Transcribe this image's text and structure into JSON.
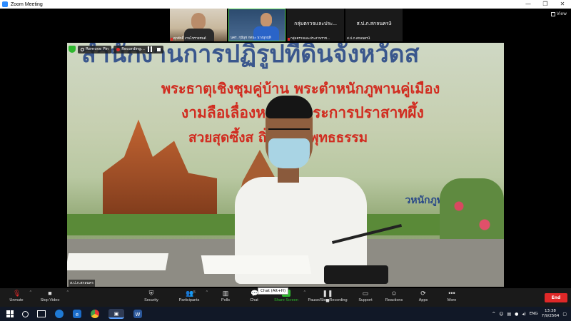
{
  "window": {
    "title": "Zoom Meeting",
    "controls": [
      "—",
      "❐",
      "✕"
    ]
  },
  "thumbnails": [
    {
      "label": "ศุภศักดิ์ งานไขรายชนด์",
      "muted": true
    },
    {
      "label": "นคร. กุนีนุช กตนะ นางนุกฤทิ",
      "muted": false
    },
    {
      "name": "กลุ่มตรวจและประ...",
      "label": "กลุ่มตรวจและประสานราช...",
      "muted": true
    },
    {
      "name": "ส.ป.ภ.สกลนคร3",
      "label": "ส.ป.ภ.สกลนคร3",
      "muted": false
    }
  ],
  "view_label": "View",
  "banner": {
    "remove_pin": "Remove Pin",
    "recording": "Recording..."
  },
  "video": {
    "line0": "สำนักงานการปฏิรูปที่ดินจังหวัดส",
    "line1": "พระธาตุเชิงชุมคู่บ้าน   พระตำหนักภูพานคู่เมือง",
    "line2": "งามลือเลื่องห          ร แลตระการปราสาทผึ้ง",
    "line3": "สวยสุดซึ้งส          ถิ่นมั่นในพุทธธรรม",
    "sign": "วหนักภูพานร",
    "name": "ส.ป.ภ.สกลนคร"
  },
  "toolbar": {
    "unmute": "Unmute",
    "stop_video": "Stop Video",
    "security": "Security",
    "participants": "Participants",
    "participants_count": "5",
    "polls": "Polls",
    "chat": "Chat",
    "share_screen": "Share Screen",
    "pause_recording": "Pause/Stop Recording",
    "support": "Support",
    "reactions": "Reactions",
    "apps": "Apps",
    "more": "More",
    "end": "End",
    "tooltip": "Chat (Alt+H)"
  },
  "taskbar": {
    "lang": "ENG",
    "time": "13:38",
    "date": "7/9/2564"
  }
}
